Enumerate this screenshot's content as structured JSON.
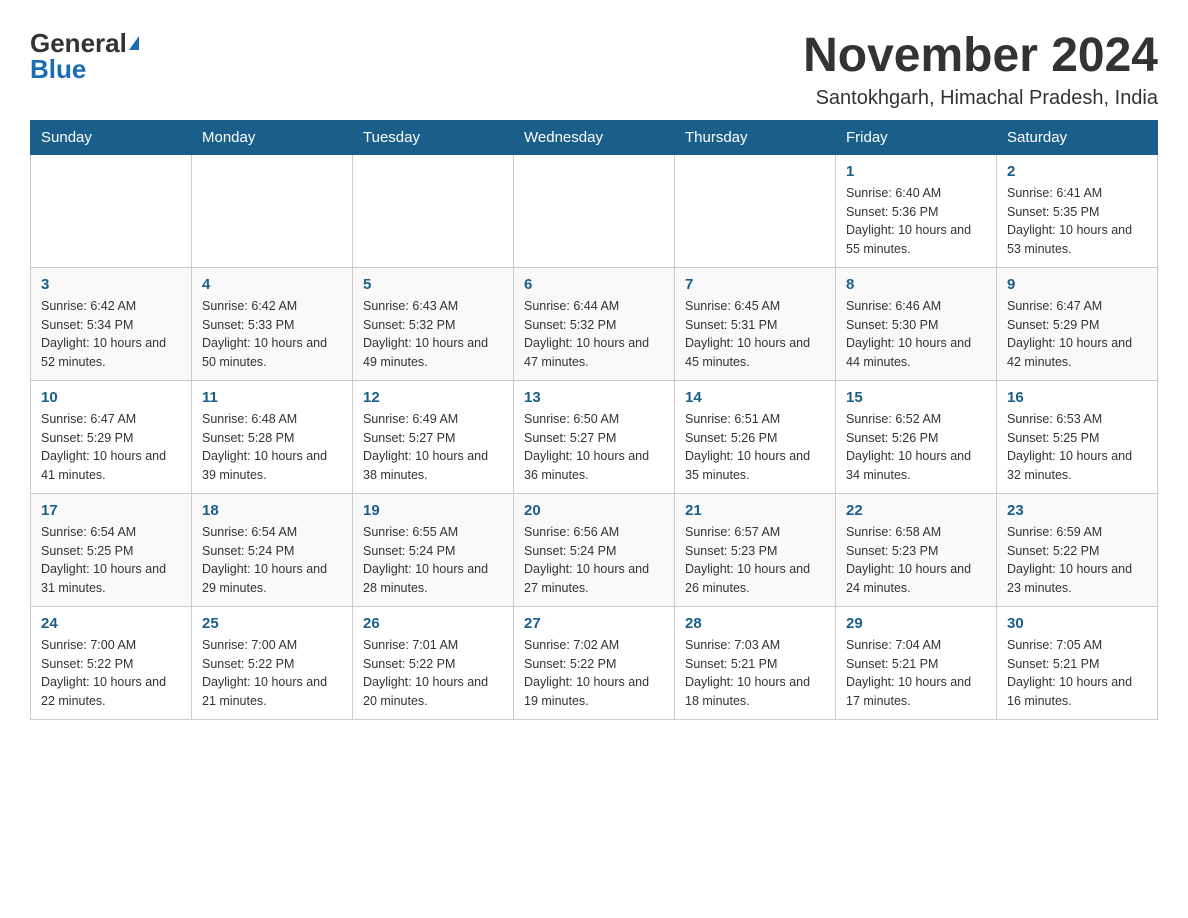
{
  "logo": {
    "general": "General",
    "blue": "Blue"
  },
  "title": "November 2024",
  "location": "Santokhgarh, Himachal Pradesh, India",
  "days_of_week": [
    "Sunday",
    "Monday",
    "Tuesday",
    "Wednesday",
    "Thursday",
    "Friday",
    "Saturday"
  ],
  "weeks": [
    [
      null,
      null,
      null,
      null,
      null,
      {
        "day": "1",
        "sunrise": "6:40 AM",
        "sunset": "5:36 PM",
        "daylight": "10 hours and 55 minutes."
      },
      {
        "day": "2",
        "sunrise": "6:41 AM",
        "sunset": "5:35 PM",
        "daylight": "10 hours and 53 minutes."
      }
    ],
    [
      {
        "day": "3",
        "sunrise": "6:42 AM",
        "sunset": "5:34 PM",
        "daylight": "10 hours and 52 minutes."
      },
      {
        "day": "4",
        "sunrise": "6:42 AM",
        "sunset": "5:33 PM",
        "daylight": "10 hours and 50 minutes."
      },
      {
        "day": "5",
        "sunrise": "6:43 AM",
        "sunset": "5:32 PM",
        "daylight": "10 hours and 49 minutes."
      },
      {
        "day": "6",
        "sunrise": "6:44 AM",
        "sunset": "5:32 PM",
        "daylight": "10 hours and 47 minutes."
      },
      {
        "day": "7",
        "sunrise": "6:45 AM",
        "sunset": "5:31 PM",
        "daylight": "10 hours and 45 minutes."
      },
      {
        "day": "8",
        "sunrise": "6:46 AM",
        "sunset": "5:30 PM",
        "daylight": "10 hours and 44 minutes."
      },
      {
        "day": "9",
        "sunrise": "6:47 AM",
        "sunset": "5:29 PM",
        "daylight": "10 hours and 42 minutes."
      }
    ],
    [
      {
        "day": "10",
        "sunrise": "6:47 AM",
        "sunset": "5:29 PM",
        "daylight": "10 hours and 41 minutes."
      },
      {
        "day": "11",
        "sunrise": "6:48 AM",
        "sunset": "5:28 PM",
        "daylight": "10 hours and 39 minutes."
      },
      {
        "day": "12",
        "sunrise": "6:49 AM",
        "sunset": "5:27 PM",
        "daylight": "10 hours and 38 minutes."
      },
      {
        "day": "13",
        "sunrise": "6:50 AM",
        "sunset": "5:27 PM",
        "daylight": "10 hours and 36 minutes."
      },
      {
        "day": "14",
        "sunrise": "6:51 AM",
        "sunset": "5:26 PM",
        "daylight": "10 hours and 35 minutes."
      },
      {
        "day": "15",
        "sunrise": "6:52 AM",
        "sunset": "5:26 PM",
        "daylight": "10 hours and 34 minutes."
      },
      {
        "day": "16",
        "sunrise": "6:53 AM",
        "sunset": "5:25 PM",
        "daylight": "10 hours and 32 minutes."
      }
    ],
    [
      {
        "day": "17",
        "sunrise": "6:54 AM",
        "sunset": "5:25 PM",
        "daylight": "10 hours and 31 minutes."
      },
      {
        "day": "18",
        "sunrise": "6:54 AM",
        "sunset": "5:24 PM",
        "daylight": "10 hours and 29 minutes."
      },
      {
        "day": "19",
        "sunrise": "6:55 AM",
        "sunset": "5:24 PM",
        "daylight": "10 hours and 28 minutes."
      },
      {
        "day": "20",
        "sunrise": "6:56 AM",
        "sunset": "5:24 PM",
        "daylight": "10 hours and 27 minutes."
      },
      {
        "day": "21",
        "sunrise": "6:57 AM",
        "sunset": "5:23 PM",
        "daylight": "10 hours and 26 minutes."
      },
      {
        "day": "22",
        "sunrise": "6:58 AM",
        "sunset": "5:23 PM",
        "daylight": "10 hours and 24 minutes."
      },
      {
        "day": "23",
        "sunrise": "6:59 AM",
        "sunset": "5:22 PM",
        "daylight": "10 hours and 23 minutes."
      }
    ],
    [
      {
        "day": "24",
        "sunrise": "7:00 AM",
        "sunset": "5:22 PM",
        "daylight": "10 hours and 22 minutes."
      },
      {
        "day": "25",
        "sunrise": "7:00 AM",
        "sunset": "5:22 PM",
        "daylight": "10 hours and 21 minutes."
      },
      {
        "day": "26",
        "sunrise": "7:01 AM",
        "sunset": "5:22 PM",
        "daylight": "10 hours and 20 minutes."
      },
      {
        "day": "27",
        "sunrise": "7:02 AM",
        "sunset": "5:22 PM",
        "daylight": "10 hours and 19 minutes."
      },
      {
        "day": "28",
        "sunrise": "7:03 AM",
        "sunset": "5:21 PM",
        "daylight": "10 hours and 18 minutes."
      },
      {
        "day": "29",
        "sunrise": "7:04 AM",
        "sunset": "5:21 PM",
        "daylight": "10 hours and 17 minutes."
      },
      {
        "day": "30",
        "sunrise": "7:05 AM",
        "sunset": "5:21 PM",
        "daylight": "10 hours and 16 minutes."
      }
    ]
  ]
}
